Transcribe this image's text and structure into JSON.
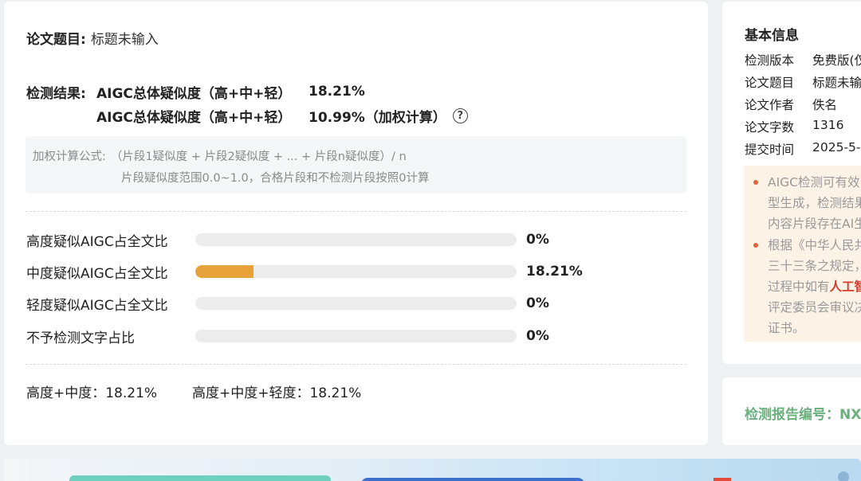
{
  "paper": {
    "title_label": "论文题目:",
    "title_value": "标题未输入"
  },
  "result": {
    "label": "检测结果:",
    "lines": [
      {
        "metric": "AIGC总体疑似度（高+中+轻）",
        "value": "18.21%"
      },
      {
        "metric": "AIGC总体疑似度（高+中+轻）",
        "value": "10.99%（加权计算）"
      }
    ],
    "help_icon": "question-circle-icon"
  },
  "formula": {
    "label": "加权计算公式:",
    "expression": "（片段1疑似度 + 片段2疑似度 + ... + 片段n疑似度）/ n",
    "note": "片段疑似度范围0.0~1.0，合格片段和不检测片段按照0计算"
  },
  "bars": [
    {
      "label": "高度疑似AIGC占全文比",
      "value": "0%",
      "fraction": 0.0
    },
    {
      "label": "中度疑似AIGC占全文比",
      "value": "18.21%",
      "fraction": 0.1821
    },
    {
      "label": "轻度疑似AIGC占全文比",
      "value": "0%",
      "fraction": 0.0
    },
    {
      "label": "不予检测文字占比",
      "value": "0%",
      "fraction": 0.0
    }
  ],
  "summary": {
    "high_mid": "高度+中度：18.21%",
    "high_mid_low": "高度+中度+轻度：18.21%"
  },
  "basic_info": {
    "heading": "基本信息",
    "rows": [
      {
        "key": "检测版本",
        "value": "免费版(仅"
      },
      {
        "key": "论文题目",
        "value": "标题未输"
      },
      {
        "key": "论文作者",
        "value": "佚名"
      },
      {
        "key": "论文字数",
        "value": "1316"
      },
      {
        "key": "提交时间",
        "value": "2025-5-"
      }
    ]
  },
  "notice": {
    "item1_lines": [
      "AIGC检测可有效",
      "型生成，检测结果",
      "内容片段存在AI生"
    ],
    "item2_line1": "根据《中华人民共",
    "item2_line2": "三十三条之规定，",
    "item2_line3_prefix": "过程中如有",
    "item2_line3_highlight": "人工智",
    "item2_line4": "评定委员会审议决",
    "item2_line5": "证书。"
  },
  "report": {
    "label": "检测报告编号：NX"
  },
  "colors": {
    "bar_fill": "#e8a23a",
    "bar_track": "#ececec",
    "report_green": "#6ab07c",
    "notice_bg": "#fdf2e6",
    "highlight_red": "#d63b2e"
  }
}
